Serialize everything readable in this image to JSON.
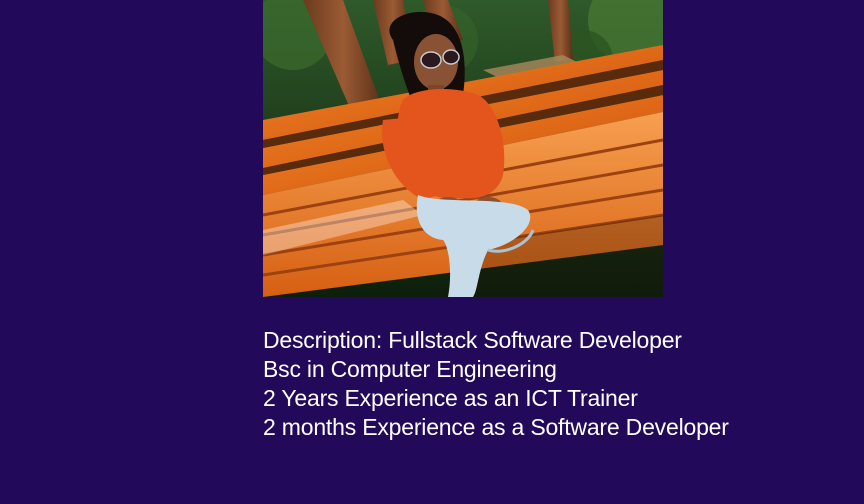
{
  "colors": {
    "background": "#22095a",
    "text": "#ffffff"
  },
  "profile": {
    "photo_icon": "profile-photo",
    "lines": [
      "Description: Fullstack Software Developer",
      "Bsc in Computer Engineering",
      "2 Years Experience as an ICT Trainer",
      "2 months Experience as a Software Developer"
    ]
  }
}
